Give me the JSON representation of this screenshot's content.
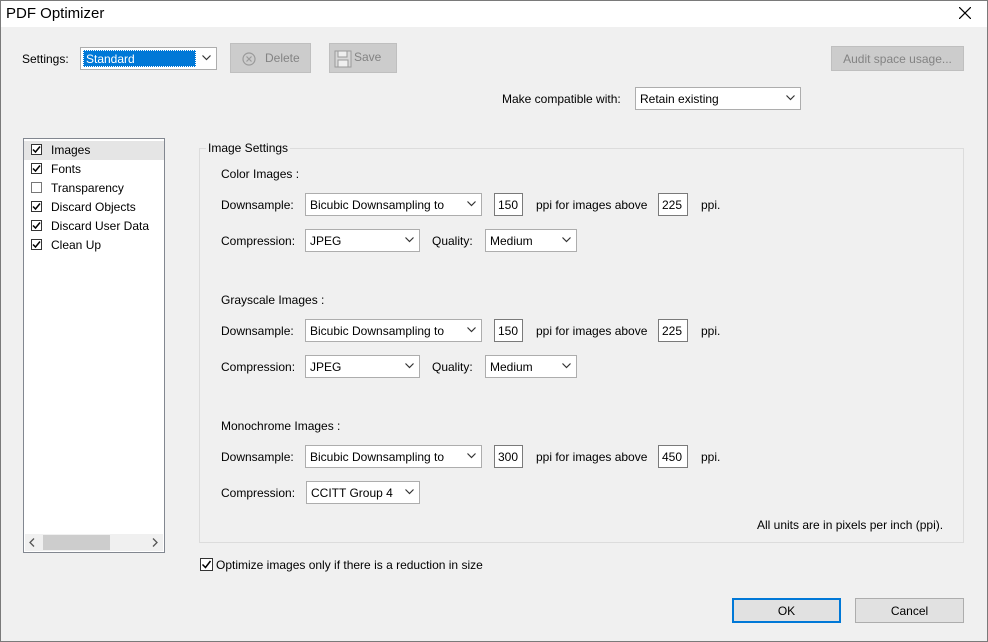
{
  "window": {
    "title": "PDF Optimizer",
    "close_label": "close"
  },
  "top": {
    "settings_label": "Settings:",
    "settings_value": "Standard",
    "delete_label": "Delete",
    "save_label": "Save",
    "audit_label": "Audit space usage...",
    "compat_label": "Make compatible with:",
    "compat_value": "Retain existing"
  },
  "sidebar": {
    "items": [
      {
        "label": "Images",
        "checked": true,
        "selected": true
      },
      {
        "label": "Fonts",
        "checked": true,
        "selected": false
      },
      {
        "label": "Transparency",
        "checked": false,
        "selected": false
      },
      {
        "label": "Discard Objects",
        "checked": true,
        "selected": false
      },
      {
        "label": "Discard User Data",
        "checked": true,
        "selected": false
      },
      {
        "label": "Clean Up",
        "checked": true,
        "selected": false
      }
    ]
  },
  "image_settings": {
    "group_title": "Image Settings",
    "color": {
      "heading": "Color Images :",
      "downsample_label": "Downsample:",
      "downsample_value": "Bicubic Downsampling to",
      "ppi_value": "150",
      "above_label": "ppi for images above",
      "above_value": "225",
      "ppi_unit": "ppi.",
      "compression_label": "Compression:",
      "compression_value": "JPEG",
      "quality_label": "Quality:",
      "quality_value": "Medium"
    },
    "grayscale": {
      "heading": "Grayscale Images :",
      "downsample_label": "Downsample:",
      "downsample_value": "Bicubic Downsampling to",
      "ppi_value": "150",
      "above_label": "ppi for images above",
      "above_value": "225",
      "ppi_unit": "ppi.",
      "compression_label": "Compression:",
      "compression_value": "JPEG",
      "quality_label": "Quality:",
      "quality_value": "Medium"
    },
    "mono": {
      "heading": "Monochrome Images :",
      "downsample_label": "Downsample:",
      "downsample_value": "Bicubic Downsampling to",
      "ppi_value": "300",
      "above_label": "ppi for images above",
      "above_value": "450",
      "ppi_unit": "ppi.",
      "compression_label": "Compression:",
      "compression_value": "CCITT Group 4"
    },
    "units_note": "All units are in pixels per inch (ppi)."
  },
  "footer": {
    "optimize_label": "Optimize images only if there is a reduction in size",
    "optimize_checked": true,
    "ok_label": "OK",
    "cancel_label": "Cancel"
  },
  "colors": {
    "selection": "#0078d7",
    "accent_border": "#0078d7"
  }
}
